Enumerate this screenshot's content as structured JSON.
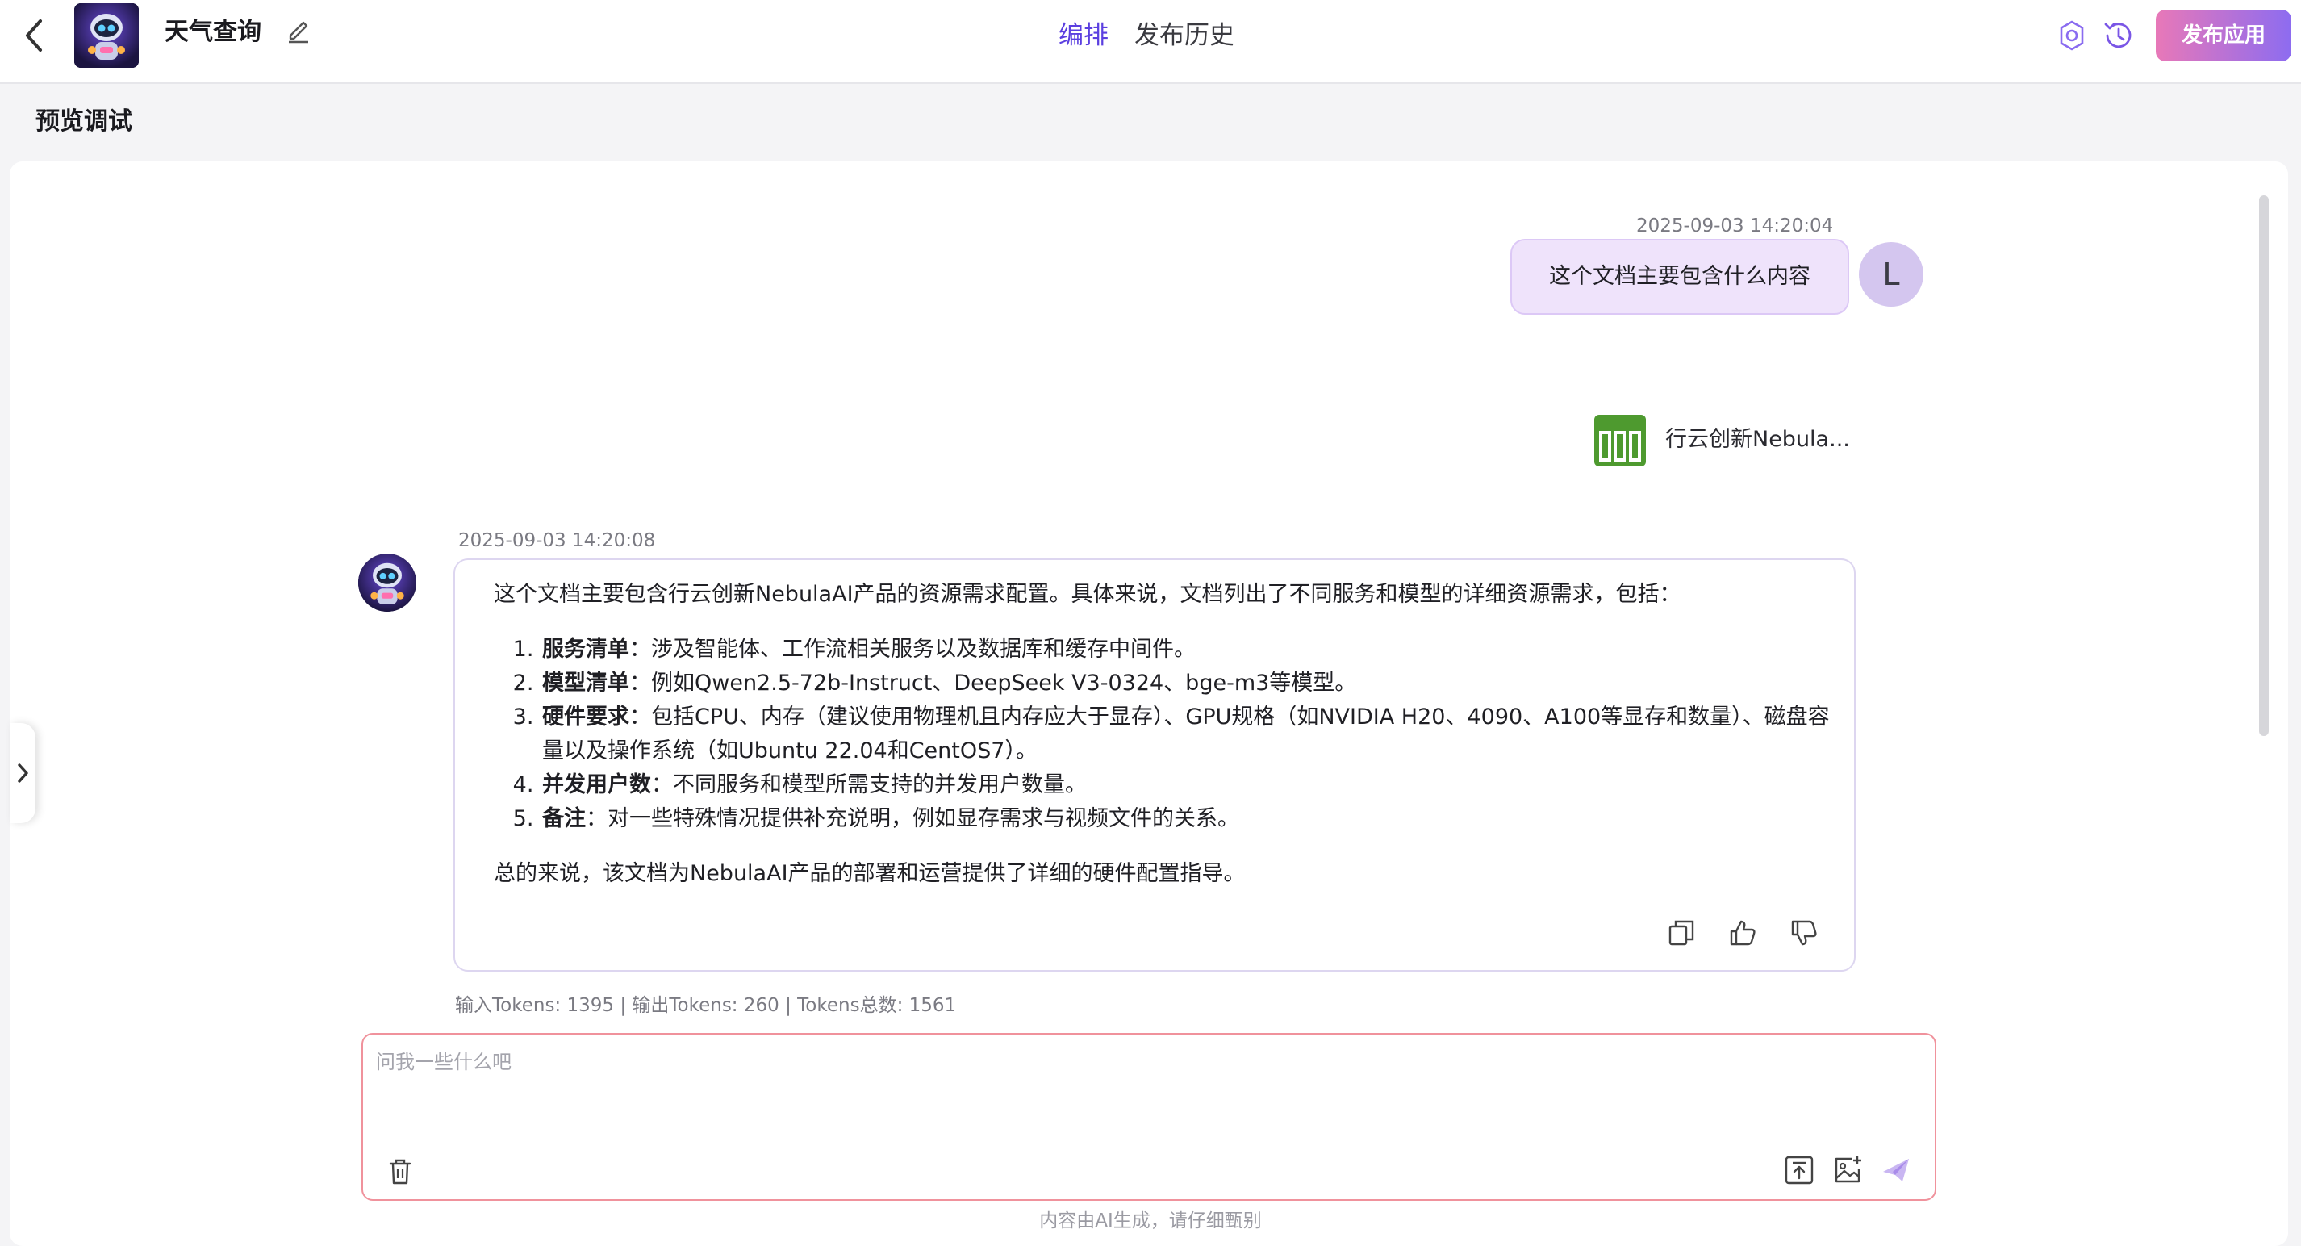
{
  "header": {
    "app_title": "天气查询",
    "tabs": [
      {
        "label": "编排",
        "active": true
      },
      {
        "label": "发布历史",
        "active": false
      }
    ],
    "publish_label": "发布应用",
    "accent_color": "#5b3fe0"
  },
  "section_title": "预览调试",
  "conversation": {
    "user_message": {
      "timestamp": "2025-09-03 14:20:04",
      "text": "这个文档主要包含什么内容",
      "avatar_letter": "L"
    },
    "attachment": {
      "file_name": "行云创新Nebula...",
      "icon": "spreadsheet-icon"
    },
    "bot_message": {
      "timestamp": "2025-09-03 14:20:08",
      "intro": "这个文档主要包含行云创新NebulaAI产品的资源需求配置。具体来说，文档列出了不同服务和模型的详细资源需求，包括：",
      "items": [
        {
          "term": "服务清单",
          "desc": "：涉及智能体、工作流相关服务以及数据库和缓存中间件。"
        },
        {
          "term": "模型清单",
          "desc": "：例如Qwen2.5-72b-Instruct、DeepSeek V3-0324、bge-m3等模型。"
        },
        {
          "term": "硬件要求",
          "desc": "：包括CPU、内存（建议使用物理机且内存应大于显存）、GPU规格（如NVIDIA H20、4090、A100等显存和数量）、磁盘容量以及操作系统（如Ubuntu 22.04和CentOS7）。"
        },
        {
          "term": "并发用户数",
          "desc": "：不同服务和模型所需支持的并发用户数量。"
        },
        {
          "term": "备注",
          "desc": "：对一些特殊情况提供补充说明，例如显存需求与视频文件的关系。"
        }
      ],
      "conclusion": "总的来说，该文档为NebulaAI产品的部署和运营提供了详细的硬件配置指导。"
    },
    "tokens": "输入Tokens: 1395 |  输出Tokens: 260 |  Tokens总数: 1561"
  },
  "input": {
    "placeholder": "问我一些什么吧",
    "value": ""
  },
  "disclaimer": "内容由AI生成，请仔细甄别"
}
